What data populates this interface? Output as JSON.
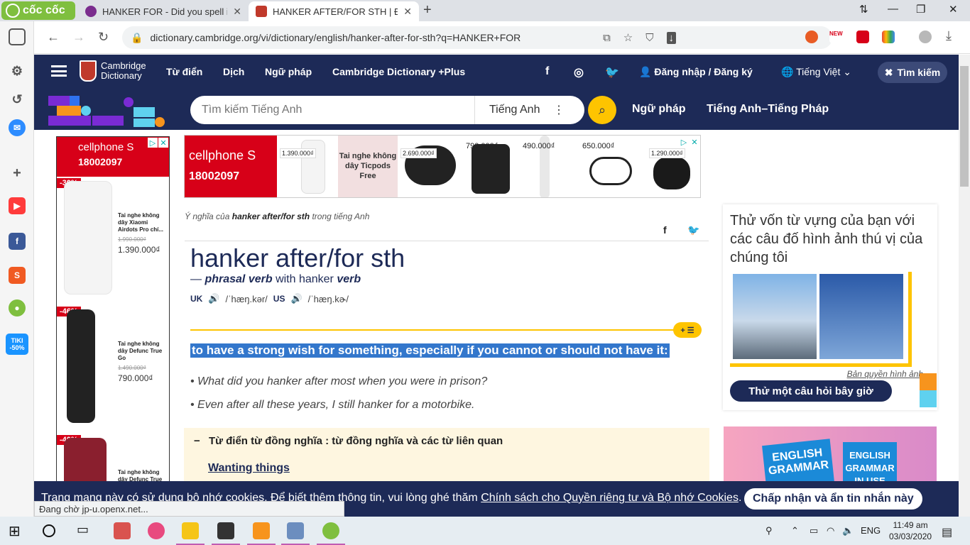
{
  "browser": {
    "brand": "cốc cốc",
    "tabs": [
      {
        "title": "HANKER FOR - Did you spell it",
        "active": false
      },
      {
        "title": "HANKER AFTER/FOR STH | Đị",
        "active": true
      }
    ],
    "url": "dictionary.cambridge.org/vi/dictionary/english/hanker-after-for-sth?q=HANKER+FOR",
    "ext_new_label": "NEW",
    "tiki_label": "TIKI -50%"
  },
  "header": {
    "logo_line1": "Cambridge",
    "logo_line2": "Dictionary",
    "nav": [
      "Từ điển",
      "Dịch",
      "Ngữ pháp",
      "Cambridge Dictionary +Plus"
    ],
    "signin": "Đăng nhập / Đăng ký",
    "language": "Tiếng Việt",
    "search_toggle": "Tìm kiếm"
  },
  "search": {
    "placeholder": "Tìm kiếm Tiếng Anh",
    "dictionary": "Tiếng Anh",
    "links": [
      "Ngữ pháp",
      "Tiếng Anh–Tiếng Pháp"
    ]
  },
  "ad_left": {
    "brand": "cellphone S",
    "phone": "18002097",
    "items": [
      {
        "discount": "-30%",
        "name": "Tai nghe không dây Xiaomi Airdots Pro chí...",
        "old_price": "1.990.000₫",
        "price": "1.390.000₫"
      },
      {
        "discount": "-46%",
        "name": "Tai nghe không dây Defunc True Go",
        "old_price": "1.490.000₫",
        "price": "790.000₫"
      },
      {
        "discount": "-40%",
        "name": "Tai nghe không dây Defunc True",
        "old_price": "",
        "price": ""
      }
    ]
  },
  "ad_top": {
    "brand": "cellphone S",
    "phone": "18002097",
    "free_text": "Tai nghe không dây Ticpods Free",
    "prices": [
      "1.390.000₫",
      "2.690.000₫",
      "790.000₫",
      "490.000₫",
      "650.000₫",
      "1.290.000₫"
    ]
  },
  "entry": {
    "breadcrumb_prefix": "Ý nghĩa của",
    "breadcrumb_word": "hanker after/for sth",
    "breadcrumb_suffix": "trong tiếng Anh",
    "headword": "hanker after/for sth",
    "pos_dash": "—",
    "pos": "phrasal verb",
    "pos_with": "with hanker",
    "pos_verb": "verb",
    "uk_label": "UK",
    "uk_ipa": "/ˈhæŋ.kər/",
    "us_label": "US",
    "us_ipa": "/ˈhæŋ.kɚ/",
    "definition": "to have a strong wish for something, especially if you cannot or should not have it:",
    "examples": [
      "What did you hanker after most when you were in prison?",
      "Even after all these years, I still hanker for a motorbike."
    ],
    "thesaurus_heading": "Từ điển từ đồng nghĩa : từ đồng nghĩa và các từ liên quan",
    "thesaurus_link": "Wanting things"
  },
  "quiz": {
    "title": "Thử vốn từ vựng của bạn với các câu đố hình ảnh thú vị của chúng tôi",
    "credit": "Bản quyền hình ảnh",
    "button": "Thử một câu hỏi bây giờ"
  },
  "grammar_ad": {
    "book1": "ENGLISH GRAMMAR",
    "book2": "ENGLISH GRAMMAR IN USE"
  },
  "cookie": {
    "text": "Trang mạng này có sử dụng bộ nhớ cookies. Để biết thêm thông tin, vui lòng ghé thăm",
    "link": "Chính sách cho Quyền riêng tư và Bộ nhớ Cookies",
    "button": "Chấp nhận và ẩn tin nhắn này"
  },
  "status_bar": "Đang chờ jp-u.openx.net...",
  "taskbar": {
    "lang": "ENG",
    "time": "11:49 am",
    "date": "03/03/2020"
  },
  "colors": {
    "cambridge_navy": "#1d2a57",
    "cambridge_yellow": "#fec400",
    "cellphones_red": "#d70018",
    "highlight_blue": "#3377cc"
  }
}
